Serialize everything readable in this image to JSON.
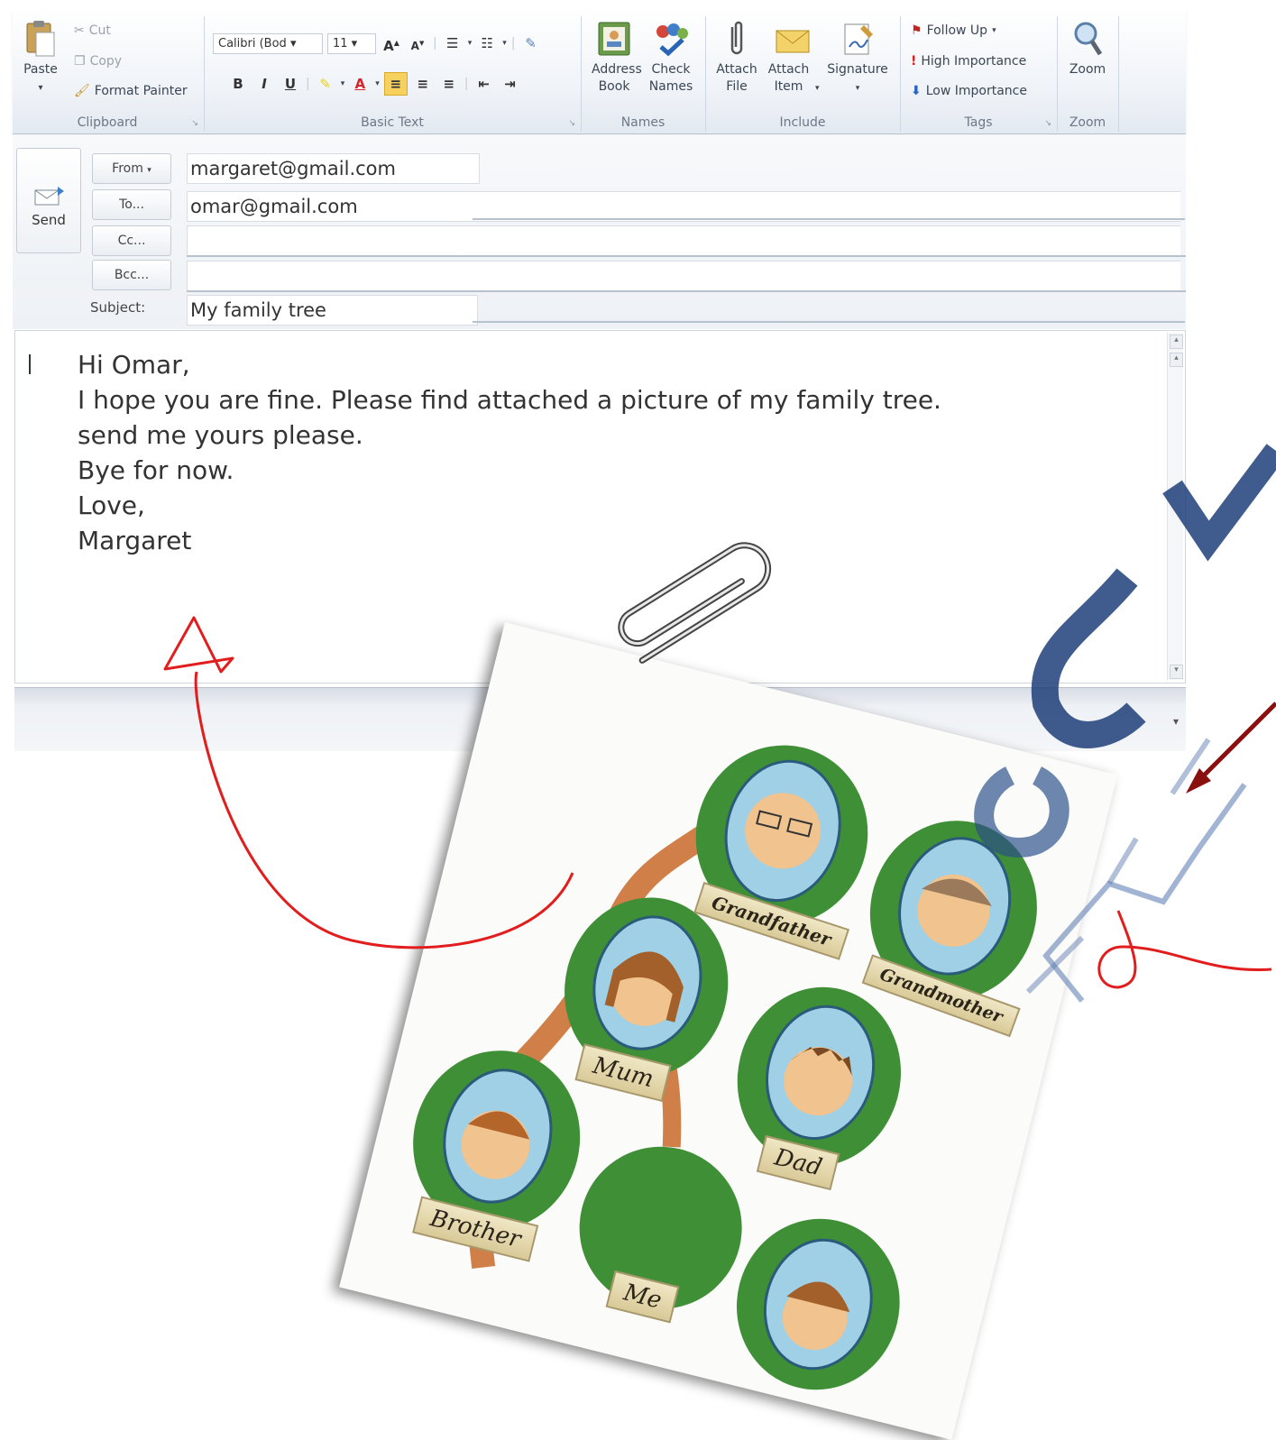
{
  "ribbon": {
    "clipboard": {
      "paste": "Paste",
      "cut": "Cut",
      "copy": "Copy",
      "format_painter": "Format Painter",
      "label": "Clipboard"
    },
    "basic_text": {
      "font": "Calibri (Bod",
      "size": "11",
      "bold": "B",
      "italic": "I",
      "underline": "U",
      "label": "Basic Text"
    },
    "names": {
      "address_book": "Address Book",
      "check_names": "Check Names",
      "label": "Names"
    },
    "include": {
      "attach_file": "Attach File",
      "attach_item": "Attach Item",
      "signature": "Signature",
      "label": "Include"
    },
    "tags": {
      "follow_up": "Follow Up",
      "high_importance": "High Importance",
      "low_importance": "Low Importance",
      "label": "Tags"
    },
    "zoom": {
      "zoom": "Zoom",
      "label": "Zoom"
    }
  },
  "header": {
    "send": "Send",
    "from_btn": "From",
    "from": "margaret@gmail.com",
    "to_btn": "To...",
    "to": "omar@gmail.com",
    "cc_btn": "Cc...",
    "cc": "",
    "bcc_btn": "Bcc...",
    "bcc": "",
    "subject_label": "Subject:",
    "subject": "My family tree"
  },
  "body": {
    "lines": [
      "Hi Omar,",
      "I hope you are fine. Please find attached a picture of my family tree.",
      "send me yours please.",
      "Bye for now.",
      "Love,",
      "Margaret"
    ]
  },
  "photo": {
    "labels": [
      "Grandfather",
      "Grandmother",
      "Mum",
      "Dad",
      "Brother",
      "Me"
    ]
  },
  "colors": {
    "accent": "#1f5f9f",
    "annotation": "#e11d1d",
    "tree_green": "#3e8f36",
    "portrait_blue": "#9fd0e6"
  }
}
